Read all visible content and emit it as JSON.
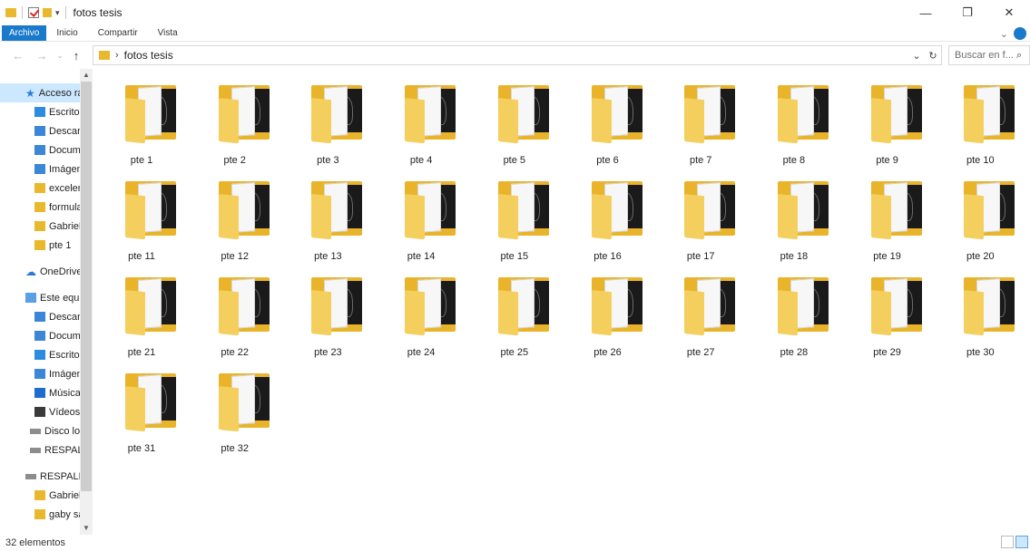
{
  "window": {
    "title": "fotos tesis"
  },
  "ribbon": {
    "tabs": [
      "Archivo",
      "Inicio",
      "Compartir",
      "Vista"
    ]
  },
  "address": {
    "path": "fotos tesis"
  },
  "search": {
    "placeholder": "Buscar en f..."
  },
  "nav": {
    "items": [
      {
        "label": "Acceso rápido",
        "icon": "star-icon"
      },
      {
        "label": "Escritorio",
        "icon": "folder-blue-icon"
      },
      {
        "label": "Descargas",
        "icon": "download-icon"
      },
      {
        "label": "Documentos",
        "icon": "documents-icon"
      },
      {
        "label": "Imágenes",
        "icon": "pictures-icon"
      },
      {
        "label": "excelente",
        "icon": "folder-icon"
      },
      {
        "label": "formulas",
        "icon": "folder-icon"
      },
      {
        "label": "Gabriela",
        "icon": "folder-icon"
      },
      {
        "label": "pte 1",
        "icon": "folder-icon"
      },
      {
        "label": "OneDrive",
        "icon": "cloud-icon"
      },
      {
        "label": "Este equipo",
        "icon": "pc-icon"
      },
      {
        "label": "Descargas",
        "icon": "download-icon"
      },
      {
        "label": "Documentos",
        "icon": "documents-icon"
      },
      {
        "label": "Escritorio",
        "icon": "folder-blue-icon"
      },
      {
        "label": "Imágenes",
        "icon": "pictures-icon"
      },
      {
        "label": "Música",
        "icon": "music-icon"
      },
      {
        "label": "Vídeos",
        "icon": "video-icon"
      },
      {
        "label": "Disco local",
        "icon": "drive-icon"
      },
      {
        "label": "RESPALDO",
        "icon": "drive-icon"
      },
      {
        "label": "RESPALDO",
        "icon": "drive-icon"
      },
      {
        "label": "Gabriela",
        "icon": "folder-icon"
      },
      {
        "label": "gaby sa",
        "icon": "folder-icon"
      }
    ]
  },
  "folders": [
    "pte 1",
    "pte 2",
    "pte 3",
    "pte 4",
    "pte 5",
    "pte 6",
    "pte 7",
    "pte 8",
    "pte 9",
    "pte 10",
    "pte 11",
    "pte 12",
    "pte 13",
    "pte 14",
    "pte 15",
    "pte 16",
    "pte 17",
    "pte 18",
    "pte 19",
    "pte 20",
    "pte 21",
    "pte 22",
    "pte 23",
    "pte 24",
    "pte 25",
    "pte 26",
    "pte 27",
    "pte 28",
    "pte 29",
    "pte 30",
    "pte 31",
    "pte 32"
  ],
  "status": {
    "count": "32 elementos"
  }
}
